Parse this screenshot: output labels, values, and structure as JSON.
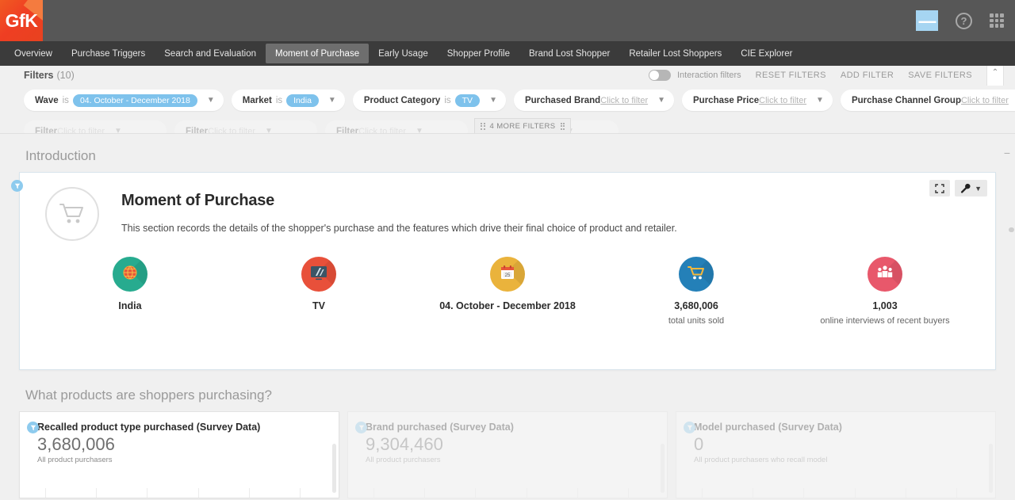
{
  "brand": {
    "logo_text": "GfK"
  },
  "topbar": {
    "icons": [
      {
        "name": "selection-icon",
        "label": ""
      },
      {
        "name": "help-icon",
        "label": "?"
      },
      {
        "name": "apps-grid-icon",
        "label": ""
      }
    ]
  },
  "nav": {
    "items": [
      {
        "label": "Overview",
        "active": false
      },
      {
        "label": "Purchase Triggers",
        "active": false
      },
      {
        "label": "Search and Evaluation",
        "active": false
      },
      {
        "label": "Moment of Purchase",
        "active": true
      },
      {
        "label": "Early Usage",
        "active": false
      },
      {
        "label": "Shopper Profile",
        "active": false
      },
      {
        "label": "Brand Lost Shopper",
        "active": false
      },
      {
        "label": "Retailer Lost Shoppers",
        "active": false
      },
      {
        "label": "CIE Explorer",
        "active": false
      }
    ]
  },
  "filters": {
    "label": "Filters",
    "count": "(10)",
    "interaction_filters_label": "Interaction filters",
    "interaction_filters_on": false,
    "actions": [
      {
        "label": "RESET FILTERS"
      },
      {
        "label": "ADD FILTER"
      },
      {
        "label": "SAVE FILTERS"
      }
    ],
    "collapse_caret": "⌃",
    "more_filters_label": "4 MORE FILTERS",
    "chips": [
      {
        "name": "Wave",
        "is": "is",
        "value": "04. October - December 2018",
        "placeholder": ""
      },
      {
        "name": "Market",
        "is": "is",
        "value": "India",
        "placeholder": ""
      },
      {
        "name": "Product Category",
        "is": "is",
        "value": "TV",
        "placeholder": ""
      },
      {
        "name": "Purchased Brand",
        "is": "",
        "value": "",
        "placeholder": "Click to filter"
      },
      {
        "name": "Purchase Price",
        "is": "",
        "value": "",
        "placeholder": "Click to filter"
      },
      {
        "name": "Purchase Channel Group",
        "is": "",
        "value": "",
        "placeholder": "Click to filter"
      }
    ],
    "chips_row2": [
      {
        "name": "Filter",
        "placeholder": "Click to filter"
      },
      {
        "name": "Filter",
        "placeholder": "Click to filter"
      },
      {
        "name": "Filter",
        "placeholder": "Click to filter"
      },
      {
        "name": "Filter",
        "placeholder": "Click to filter"
      }
    ]
  },
  "intro": {
    "section_title": "Introduction",
    "card_title": "Moment of Purchase",
    "card_description": "This section records the details of the shopper's purchase and the features which drive their final choice of product and retailer.",
    "cart_icon": "shopping-cart-icon",
    "tools": [
      {
        "name": "expand-icon"
      },
      {
        "name": "wrench-icon"
      }
    ],
    "kpis": [
      {
        "icon": "globe-icon",
        "color": "#27ab8f",
        "label": "India",
        "sub": ""
      },
      {
        "icon": "tv-icon",
        "color": "#e8503a",
        "label": "TV",
        "sub": ""
      },
      {
        "icon": "calendar-icon",
        "color": "#eab33c",
        "label": "04. October - December 2018",
        "sub": "",
        "calendar_day": "25"
      },
      {
        "icon": "cart-icon",
        "color": "#2480b8",
        "label": "3,680,006",
        "sub": "total units sold"
      },
      {
        "icon": "people-icon",
        "color": "#e8586b",
        "label": "1,003",
        "sub": "online interviews of recent buyers"
      }
    ]
  },
  "products": {
    "section_title": "What products are shoppers purchasing?",
    "cards": [
      {
        "title": "Recalled product type purchased (Survey Data)",
        "value": "3,680,006",
        "sub": "All product purchasers",
        "faded": false
      },
      {
        "title": "Brand purchased (Survey Data)",
        "value": "9,304,460",
        "sub": "All product purchasers",
        "faded": true
      },
      {
        "title": "Model purchased (Survey Data)",
        "value": "0",
        "sub": "All product purchasers who recall model",
        "faded": true
      }
    ]
  },
  "colors": {
    "brand_orange": "#ef3e23",
    "accent_blue": "#7ec2ec",
    "topbar": "#575757",
    "navbar": "#3b3b3b"
  }
}
